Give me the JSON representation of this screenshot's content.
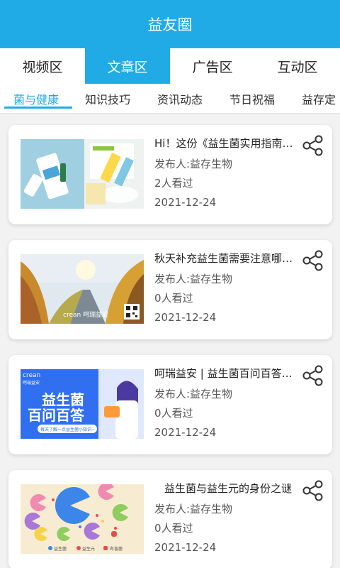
{
  "app_title": "益友圈",
  "main_tabs": [
    "视频区",
    "文章区",
    "广告区",
    "互动区"
  ],
  "sub_tabs": [
    "菌与健康",
    "知识技巧",
    "资讯动态",
    "节日祝福",
    "益存定"
  ],
  "articles": [
    {
      "title": "Hi！这份《益生菌实用指南》请收好！",
      "publisher": "发布人:益存生物",
      "views": "2人看过",
      "date": "2021-12-24",
      "thumb_icon": "probiotic-products-image"
    },
    {
      "title": "秋天补充益生菌需要注意哪些问题？",
      "publisher": "发布人:益存生物",
      "views": "0人看过",
      "date": "2021-12-24",
      "thumb_icon": "autumn-road-image",
      "thumb_text": "crean 呵瑞益安"
    },
    {
      "title": "呵瑞益安 | 益生菌百问百答（一）",
      "publisher": "发布人:益存生物",
      "views": "0人看过",
      "date": "2021-12-24",
      "thumb_icon": "doctor-banner-image",
      "thumb_brand": "crean",
      "thumb_brand_sub": "呵瑞益安",
      "thumb_line1": "益生菌",
      "thumb_line2": "百问百答",
      "thumb_caption": "每天了解一点益生菌小知识~"
    },
    {
      "title": "益生菌与益生元的身份之谜",
      "publisher": "发布人:益存生物",
      "views": "0人看过",
      "date": "2021-12-24",
      "thumb_icon": "pacman-bacteria-image",
      "thumb_legend": [
        "益生菌",
        "益生元",
        "有害菌"
      ]
    }
  ],
  "colors": {
    "accent": "#21abe6",
    "background": "#f2f2f2",
    "card": "#ffffff"
  }
}
